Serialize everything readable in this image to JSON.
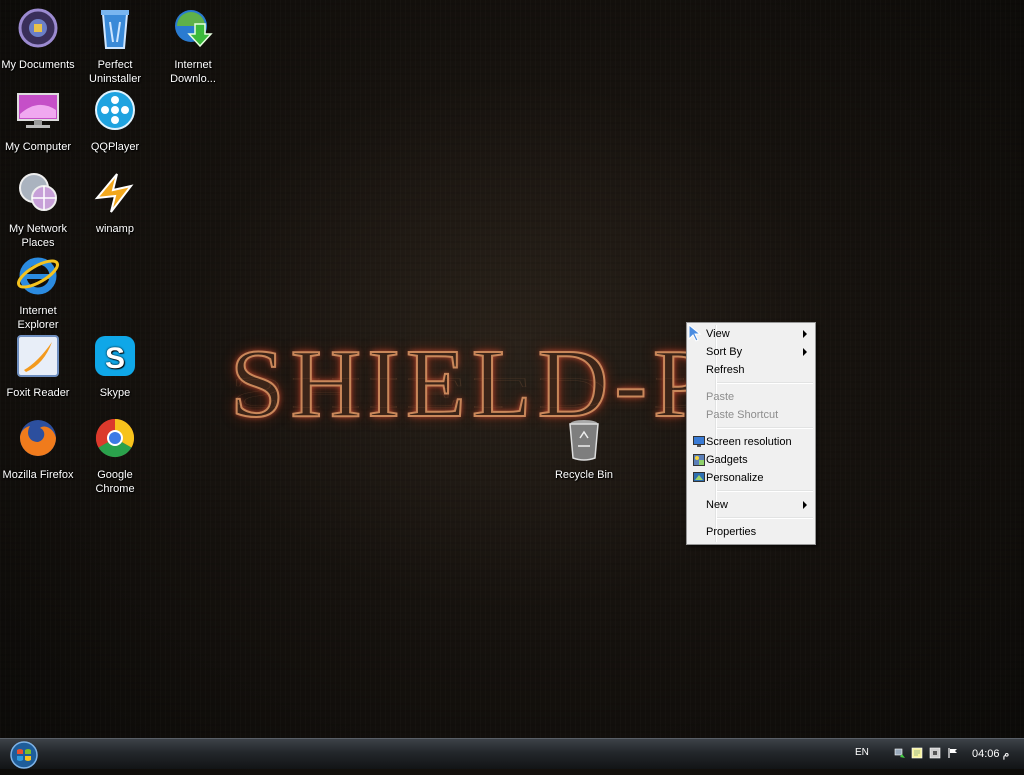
{
  "wallpaper": {
    "logo_text": "SHIELD-P"
  },
  "desktop_icons": [
    {
      "label": "My Documents"
    },
    {
      "label": "Perfect Uninstaller"
    },
    {
      "label": "Internet Downlo..."
    },
    {
      "label": "My Computer"
    },
    {
      "label": "QQPlayer"
    },
    {
      "label": "My Network Places"
    },
    {
      "label": "winamp"
    },
    {
      "label": "Internet Explorer"
    },
    {
      "label": "Foxit Reader"
    },
    {
      "label": "Skype"
    },
    {
      "label": "Mozilla Firefox"
    },
    {
      "label": "Google Chrome"
    },
    {
      "label": "Recycle Bin"
    }
  ],
  "context_menu": {
    "items": [
      {
        "label": "View",
        "submenu": true,
        "enabled": true
      },
      {
        "label": "Sort By",
        "submenu": true,
        "enabled": true
      },
      {
        "label": "Refresh",
        "enabled": true
      },
      {
        "label": "Paste",
        "enabled": false
      },
      {
        "label": "Paste Shortcut",
        "enabled": false
      },
      {
        "label": "Screen resolution",
        "icon": "monitor-icon",
        "enabled": true
      },
      {
        "label": "Gadgets",
        "icon": "gadgets-icon",
        "enabled": true
      },
      {
        "label": "Personalize",
        "icon": "personalize-icon",
        "enabled": true
      },
      {
        "label": "New",
        "submenu": true,
        "enabled": true
      },
      {
        "label": "Properties",
        "enabled": true
      }
    ]
  },
  "taskbar": {
    "language": "EN",
    "clock": "04:06 م",
    "tray_icons": [
      "network-icon",
      "notes-icon",
      "security-icon",
      "action-center-flag-icon"
    ]
  },
  "colors": {
    "menu_background": "#f0f0f0",
    "menu_border": "#979797",
    "logo_glow": "#e0553a",
    "taskbar_top": "#3d4248"
  }
}
